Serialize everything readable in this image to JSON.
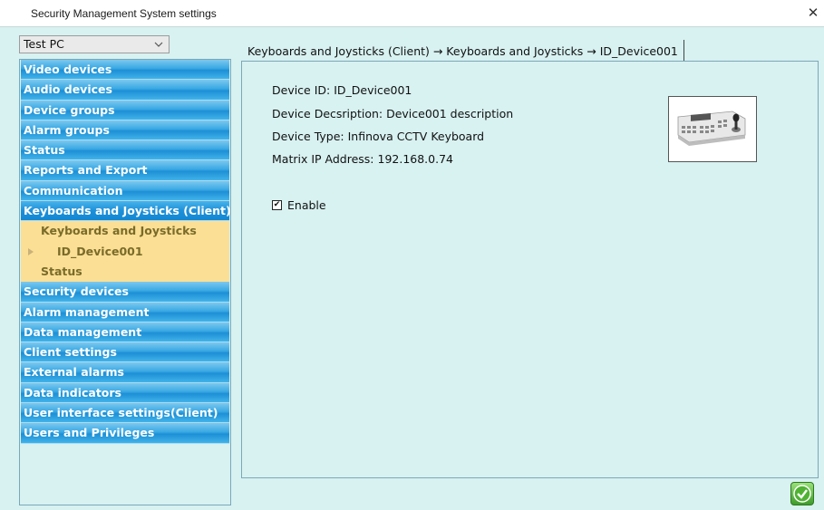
{
  "window": {
    "title": "Security Management System settings",
    "close_glyph": "✕"
  },
  "computer_select": {
    "value": "Test PC"
  },
  "nav": {
    "items_top": [
      "Video devices",
      "Audio devices",
      "Device groups",
      "Alarm groups",
      "Status",
      "Reports and Export",
      "Communication"
    ],
    "expanded": {
      "label": "Keyboards and Joysticks (Client)",
      "children": {
        "group": "Keyboards and Joysticks",
        "device": "ID_Device001",
        "status": "Status"
      }
    },
    "items_bottom": [
      "Security devices",
      "Alarm management",
      "Data management",
      "Client settings",
      "External alarms",
      "Data indicators",
      "User interface settings(Client)",
      "Users and Privileges"
    ]
  },
  "breadcrumb": "Keyboards and Joysticks (Client) → Keyboards and Joysticks → ID_Device001",
  "device": {
    "id_line": "Device ID: ID_Device001",
    "description_line": "Device Decsription: Device001 description",
    "type_line": "Device Type: Infinova CCTV Keyboard",
    "ip_line": "Matrix IP Address: 192.168.0.74"
  },
  "enable": {
    "label": "Enable",
    "checked": true,
    "check_glyph": "✔"
  },
  "colors": {
    "panel_bg": "#d8f1f1",
    "nav_blue": "#1d8fd6",
    "nav_selected": "#fbdf94",
    "ok_green": "#3d9c2a"
  },
  "icons": {
    "ok": "checkmark-icon",
    "close": "close-icon",
    "dropdown": "chevron-down-icon",
    "tree": "triangle-right-icon"
  }
}
